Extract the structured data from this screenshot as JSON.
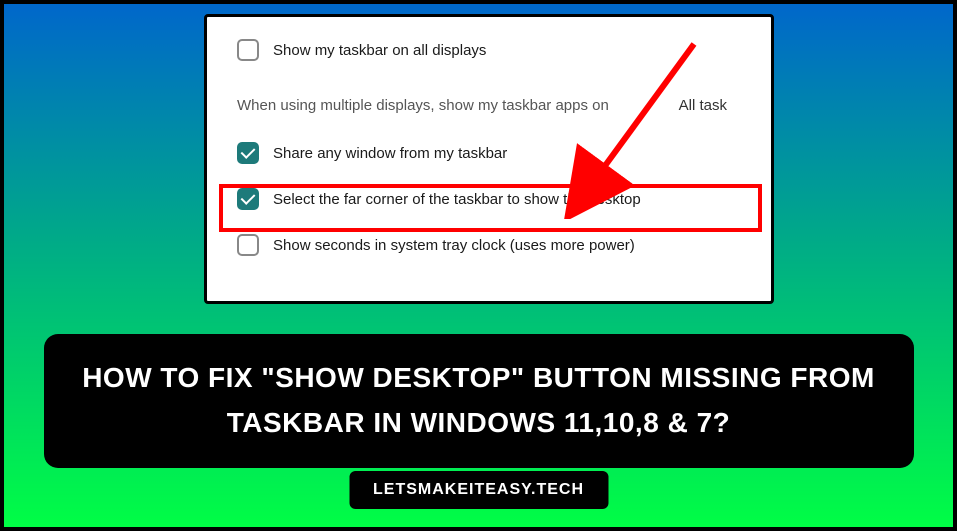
{
  "settings": {
    "row1": {
      "label": "Show my taskbar on all displays",
      "checked": false
    },
    "description": "When using multiple displays, show my taskbar apps on",
    "dropdown_value": "All task",
    "row2": {
      "label": "Share any window from my taskbar",
      "checked": true
    },
    "row3": {
      "label": "Select the far corner of the taskbar to show the desktop",
      "checked": true
    },
    "row4": {
      "label": "Show seconds in system tray clock (uses more power)",
      "checked": false
    }
  },
  "title": "HOW TO FIX \"SHOW DESKTOP\" BUTTON MISSING FROM TASKBAR IN WINDOWS 11,10,8 & 7?",
  "footer": "LETSMAKEITEASY.TECH"
}
